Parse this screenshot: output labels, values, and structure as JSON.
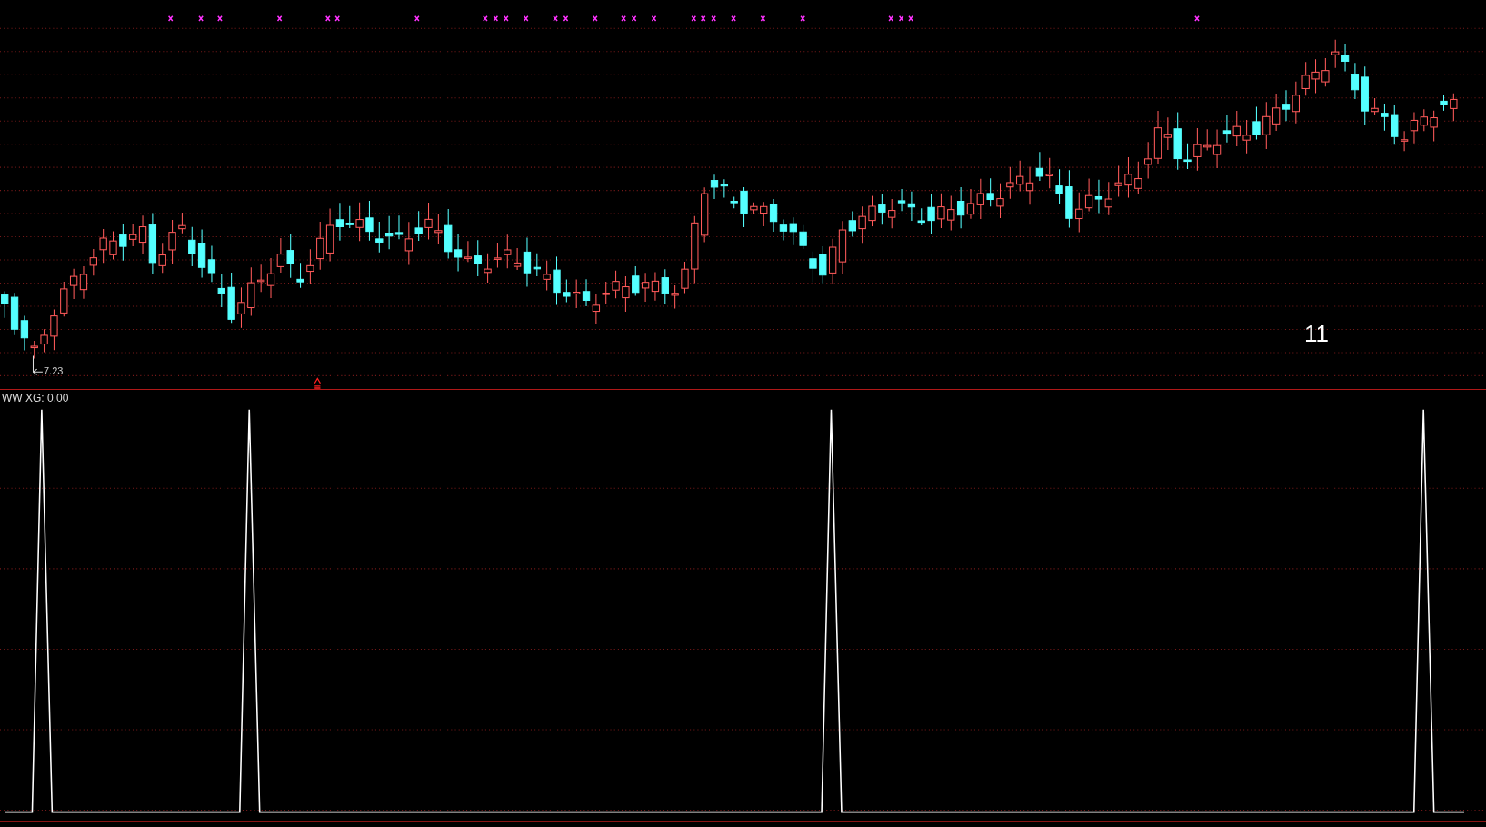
{
  "price_panel": {
    "low_label": "7.23",
    "number_label": "11"
  },
  "indicator_panel": {
    "legend": "WW XG: 0.00"
  }
}
